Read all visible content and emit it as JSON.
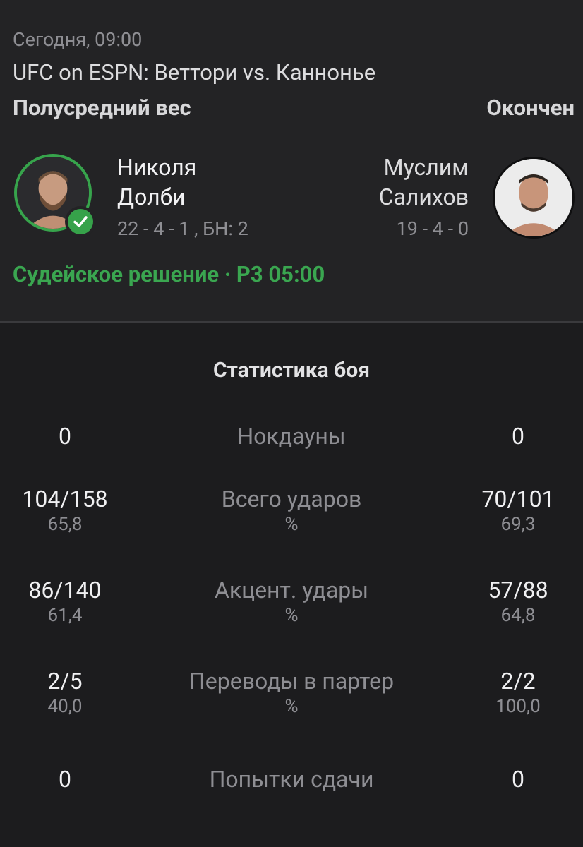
{
  "header": {
    "date": "Сегодня, 09:00",
    "event": "UFC on ESPN: Веттори vs. Каннонье",
    "weight_class": "Полусредний вес",
    "status": "Окончен"
  },
  "fighter1": {
    "first_name": "Николя",
    "last_name": "Долби",
    "record": "22 - 4 - 1 , БН: 2",
    "winner": true
  },
  "fighter2": {
    "first_name": "Муслим",
    "last_name": "Салихов",
    "record": "19 - 4 - 0"
  },
  "result": "Судейское решение · Р3 05:00",
  "colors": {
    "accent_green": "#3aa650",
    "background": "#1c1c1e",
    "header_bg": "#232325"
  },
  "stats": {
    "title": "Статистика боя",
    "rows": [
      {
        "label": "Нокдауны",
        "sub_label": "",
        "left": "0",
        "left_pct": "",
        "right": "0",
        "right_pct": ""
      },
      {
        "label": "Всего ударов",
        "sub_label": "%",
        "left": "104/158",
        "left_pct": "65,8",
        "right": "70/101",
        "right_pct": "69,3"
      },
      {
        "label": "Акцент. удары",
        "sub_label": "%",
        "left": "86/140",
        "left_pct": "61,4",
        "right": "57/88",
        "right_pct": "64,8"
      },
      {
        "label": "Переводы в партер",
        "sub_label": "%",
        "left": "2/5",
        "left_pct": "40,0",
        "right": "2/2",
        "right_pct": "100,0"
      },
      {
        "label": "Попытки сдачи",
        "sub_label": "",
        "left": "0",
        "left_pct": "",
        "right": "0",
        "right_pct": ""
      }
    ]
  }
}
